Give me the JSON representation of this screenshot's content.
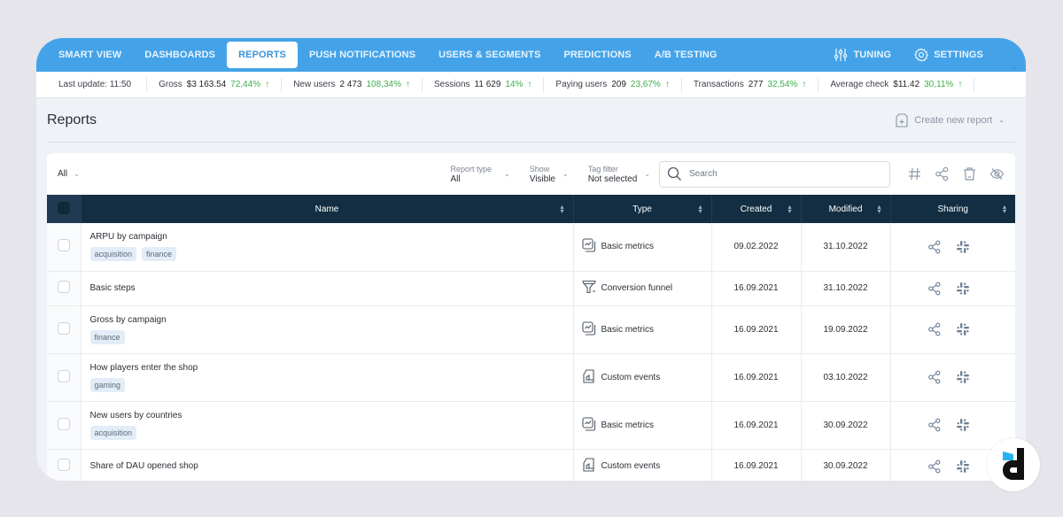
{
  "nav": {
    "items": [
      {
        "label": "SMART VIEW",
        "active": false
      },
      {
        "label": "DASHBOARDS",
        "active": false
      },
      {
        "label": "REPORTS",
        "active": true
      },
      {
        "label": "PUSH NOTIFICATIONS",
        "active": false
      },
      {
        "label": "USERS & SEGMENTS",
        "active": false
      },
      {
        "label": "PREDICTIONS",
        "active": false
      },
      {
        "label": "A/B TESTING",
        "active": false
      }
    ],
    "right": [
      {
        "label": "TUNING",
        "icon": "sliders-icon"
      },
      {
        "label": "SETTINGS",
        "icon": "gear-icon"
      }
    ],
    "accent": "#44a3e8"
  },
  "stats": {
    "last_update": "Last update: 11:50",
    "items": [
      {
        "label": "Gross",
        "value": "$3 163.54",
        "change": "72,44%",
        "arrow": "↑"
      },
      {
        "label": "New users",
        "value": "2 473",
        "change": "108,34%",
        "arrow": "↑"
      },
      {
        "label": "Sessions",
        "value": "11 629",
        "change": "14%",
        "arrow": "↑"
      },
      {
        "label": "Paying users",
        "value": "209",
        "change": "23,67%",
        "arrow": "↑"
      },
      {
        "label": "Transactions",
        "value": "277",
        "change": "32,54%",
        "arrow": "↑"
      },
      {
        "label": "Average check",
        "value": "$11.42",
        "change": "30,11%",
        "arrow": "↑"
      }
    ],
    "positive_color": "#3fae4a",
    "collapse_glyph": "^"
  },
  "page": {
    "title": "Reports",
    "create_label": "Create new report"
  },
  "toolbar": {
    "all_filter": "All",
    "report_type": {
      "label": "Report type",
      "value": "All"
    },
    "show": {
      "label": "Show",
      "value": "Visible"
    },
    "tag_filter": {
      "label": "Tag filter",
      "value": "Not selected"
    },
    "search_placeholder": "Search"
  },
  "table": {
    "columns": [
      "Name",
      "Type",
      "Created",
      "Modified",
      "Sharing"
    ],
    "header_color": "#132e42",
    "rows": [
      {
        "name": "ARPU by campaign",
        "tags": [
          "acquisition",
          "finance"
        ],
        "type": "Basic metrics",
        "type_icon": "basic-metrics-icon",
        "created": "09.02.2022",
        "modified": "31.10.2022"
      },
      {
        "name": "Basic steps",
        "tags": [],
        "type": "Conversion funnel",
        "type_icon": "funnel-icon",
        "created": "16.09.2021",
        "modified": "31.10.2022"
      },
      {
        "name": "Gross by campaign",
        "tags": [
          "finance"
        ],
        "type": "Basic metrics",
        "type_icon": "basic-metrics-icon",
        "created": "16.09.2021",
        "modified": "19.09.2022"
      },
      {
        "name": "How players enter the shop",
        "tags": [
          "gaming"
        ],
        "type": "Custom events",
        "type_icon": "custom-events-icon",
        "created": "16.09.2021",
        "modified": "03.10.2022"
      },
      {
        "name": "New users by countries",
        "tags": [
          "acquisition"
        ],
        "type": "Basic metrics",
        "type_icon": "basic-metrics-icon",
        "created": "16.09.2021",
        "modified": "30.09.2022"
      },
      {
        "name": "Share of DAU opened shop",
        "tags": [],
        "type": "Custom events",
        "type_icon": "custom-events-icon",
        "created": "16.09.2021",
        "modified": "30.09.2022"
      }
    ]
  }
}
